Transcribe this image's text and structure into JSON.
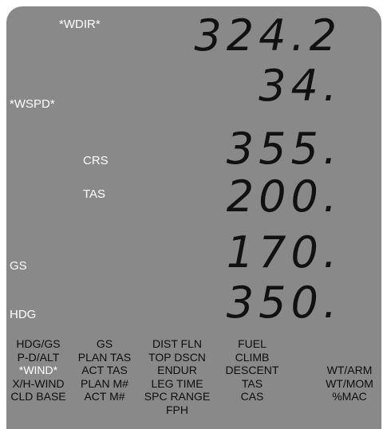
{
  "readouts": [
    {
      "label": "*WDIR*",
      "value": "324.2"
    },
    {
      "label": "*WSPD*",
      "value": "34."
    },
    {
      "label": "CRS",
      "value": "355."
    },
    {
      "label": "TAS",
      "value": "200."
    },
    {
      "label": "GS",
      "value": "170."
    },
    {
      "label": "HDG",
      "value": "350."
    }
  ],
  "menu": [
    [
      "HDG/GS",
      "P-D/ALT",
      "*WIND*",
      "X/H-WIND",
      "CLD BASE"
    ],
    [
      "GS",
      "PLAN TAS",
      "ACT TAS",
      "PLAN M#",
      "ACT M#"
    ],
    [
      "DIST FLN",
      "TOP DSCN",
      "ENDUR",
      "LEG TIME",
      "SPC RANGE",
      "FPH"
    ],
    [
      "FUEL",
      "CLIMB",
      "DESCENT",
      "TAS",
      "CAS"
    ],
    [
      "WT/ARM",
      "WT/MOM",
      "%MAC"
    ]
  ],
  "colors": {
    "lcd_bg": "#898989",
    "segment": "#111111",
    "label": "#ffffff",
    "menu_text": "#0d0d0d",
    "highlight": "#ffffff"
  }
}
